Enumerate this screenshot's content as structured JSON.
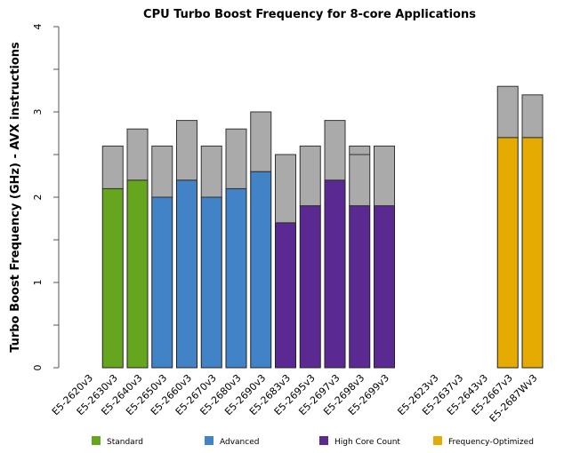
{
  "chart_data": {
    "type": "bar",
    "stacked": true,
    "title": "CPU Turbo Boost Frequency for 8-core Applications",
    "xlabel": "",
    "ylabel": "Turbo Boost Frequency (GHz) - AVX instructions",
    "ylim": [
      0,
      4
    ],
    "yticks": [
      0,
      1,
      2,
      3,
      4
    ],
    "grid": false,
    "legend_position": "bottom",
    "categories": [
      "E5-2620v3",
      "E5-2630v3",
      "E5-2640v3",
      "E5-2650v3",
      "E5-2660v3",
      "E5-2670v3",
      "E5-2680v3",
      "E5-2690v3",
      "E5-2683v3",
      "E5-2695v3",
      "E5-2697v3",
      "E5-2698v3",
      "E5-2699v3",
      "E5-2623v3",
      "E5-2637v3",
      "E5-2643v3",
      "E5-2667v3",
      "E5-2687Wv3"
    ],
    "bars": [
      {
        "category": "E5-2620v3",
        "group": null,
        "base": null,
        "turbo": null
      },
      {
        "category": "E5-2630v3",
        "group": "Standard",
        "base": 2.1,
        "turbo": 2.6
      },
      {
        "category": "E5-2640v3",
        "group": "Standard",
        "base": 2.2,
        "turbo": 2.8
      },
      {
        "category": "E5-2650v3",
        "group": "Advanced",
        "base": 2.0,
        "turbo": 2.6
      },
      {
        "category": "E5-2660v3",
        "group": "Advanced",
        "base": 2.2,
        "turbo": 2.9
      },
      {
        "category": "E5-2670v3",
        "group": "Advanced",
        "base": 2.0,
        "turbo": 2.6
      },
      {
        "category": "E5-2680v3",
        "group": "Advanced",
        "base": 2.1,
        "turbo": 2.8
      },
      {
        "category": "E5-2690v3",
        "group": "Advanced",
        "base": 2.3,
        "turbo": 3.0
      },
      {
        "category": "E5-2683v3",
        "group": "High Core Count",
        "base": 1.7,
        "turbo": 2.5
      },
      {
        "category": "E5-2695v3",
        "group": "High Core Count",
        "base": 1.9,
        "turbo": 2.6
      },
      {
        "category": "E5-2697v3",
        "group": "High Core Count",
        "base": 2.2,
        "turbo": 2.9
      },
      {
        "category": "E5-2698v3",
        "group": "High Core Count",
        "base": 1.9,
        "turbo": 2.5,
        "turbo_alt": 2.6
      },
      {
        "category": "E5-2699v3",
        "group": "High Core Count",
        "base": 1.9,
        "turbo": 2.6
      },
      {
        "category": "",
        "group": null,
        "base": null,
        "turbo": null
      },
      {
        "category": "E5-2623v3",
        "group": null,
        "base": null,
        "turbo": null
      },
      {
        "category": "E5-2637v3",
        "group": null,
        "base": null,
        "turbo": null
      },
      {
        "category": "E5-2643v3",
        "group": null,
        "base": null,
        "turbo": null
      },
      {
        "category": "E5-2667v3",
        "group": "Frequency-Optimized",
        "base": 2.7,
        "turbo": 3.3
      },
      {
        "category": "E5-2687Wv3",
        "group": "Frequency-Optimized",
        "base": 2.7,
        "turbo": 3.2
      }
    ],
    "turbo_color": "#aaaaaa",
    "legend": [
      {
        "label": "Standard",
        "color": "#66a61e"
      },
      {
        "label": "Advanced",
        "color": "#4282c6"
      },
      {
        "label": "High Core Count",
        "color": "#5a2a92"
      },
      {
        "label": "Frequency-Optimized",
        "color": "#e6ab02"
      }
    ]
  }
}
